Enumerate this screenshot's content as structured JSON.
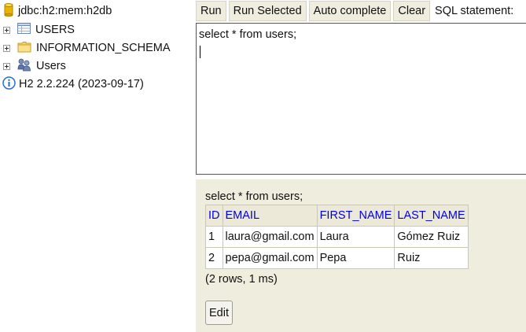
{
  "tree": {
    "connection": "jdbc:h2:mem:h2db",
    "items": [
      {
        "label": "USERS",
        "icon": "table-icon"
      },
      {
        "label": "INFORMATION_SCHEMA",
        "icon": "folder-icon"
      },
      {
        "label": "Users",
        "icon": "users-icon"
      }
    ],
    "version": "H2 2.2.224 (2023-09-17)"
  },
  "toolbar": {
    "run": "Run",
    "run_selected": "Run Selected",
    "auto_complete": "Auto complete",
    "clear": "Clear",
    "sql_label": "SQL statement:"
  },
  "editor": {
    "sql": "select * from users;"
  },
  "results": {
    "query": "select * from users;",
    "columns": [
      "ID",
      "EMAIL",
      "FIRST_NAME",
      "LAST_NAME"
    ],
    "rows": [
      [
        "1",
        "laura@gmail.com",
        "Laura",
        "Gómez Ruiz"
      ],
      [
        "2",
        "pepa@gmail.com",
        "Pepa",
        "Ruiz"
      ]
    ],
    "summary": "(2 rows, 1 ms)",
    "edit_label": "Edit"
  },
  "colors": {
    "panel_bg": "#efedde",
    "header_text": "#0000e6"
  }
}
